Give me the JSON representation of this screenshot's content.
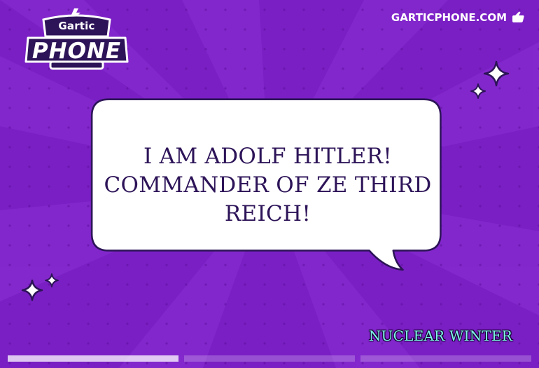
{
  "branding": {
    "logo_small": "Gartic",
    "logo_big": "PHONE",
    "site_link": "GARTICPHONE.COM",
    "site_icon": "hand-pointer-icon"
  },
  "bubble": {
    "lines": [
      "I AM ADOLF HITLER!",
      "COMMANDER OF ZE THIRD",
      "REICH!"
    ]
  },
  "author": {
    "name": "NUCLEAR WINTER"
  },
  "progress": {
    "segments_total": 3,
    "segments_filled": 1
  },
  "colors": {
    "background": "#7a1fc4",
    "bubble_fill": "#ffffff",
    "text": "#2d1458",
    "author": "#7ff3e7"
  }
}
